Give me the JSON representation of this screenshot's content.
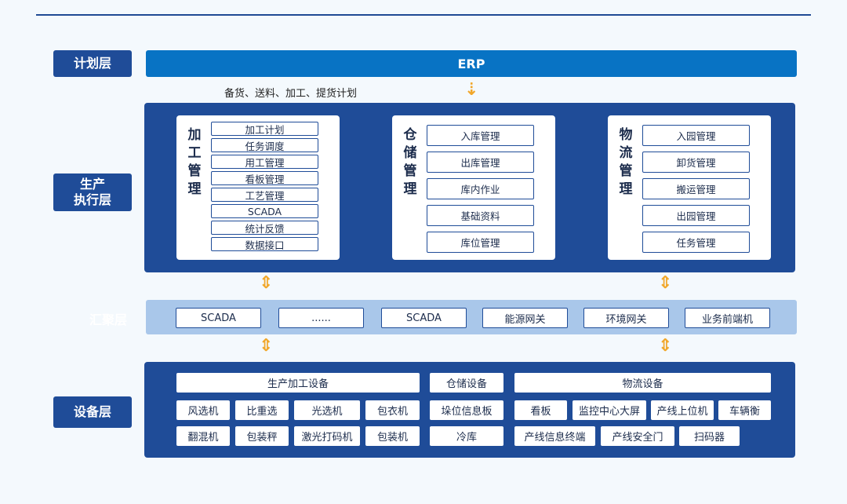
{
  "layers": {
    "plan": "计划层",
    "exec": "生产\n执行层",
    "agg": "汇聚层",
    "device": "设备层"
  },
  "erp": "ERP",
  "plan_note": "备货、送料、加工、提货计划",
  "exec_cards": [
    {
      "title": "加工管理",
      "items": [
        "加工计划",
        "任务调度",
        "用工管理",
        "看板管理",
        "工艺管理",
        "SCADA",
        "统计反馈",
        "数据接口"
      ]
    },
    {
      "title": "仓储管理",
      "items": [
        "入库管理",
        "出库管理",
        "库内作业",
        "基础资料",
        "库位管理"
      ]
    },
    {
      "title": "物流管理",
      "items": [
        "入园管理",
        "卸货管理",
        "搬运管理",
        "出园管理",
        "任务管理"
      ]
    }
  ],
  "agg_items": [
    "SCADA",
    "......",
    "SCADA",
    "能源网关",
    "环境网关",
    "业务前端机"
  ],
  "devices": {
    "groups": [
      "生产加工设备",
      "仓储设备",
      "物流设备"
    ],
    "production": [
      "风选机",
      "比重选",
      "光选机",
      "包衣机",
      "翻混机",
      "包装秤",
      "激光打码机",
      "包装机"
    ],
    "storage": [
      "垛位信息板",
      "冷库"
    ],
    "logistics": [
      "看板",
      "监控中心大屏",
      "产线上位机",
      "车辆衡",
      "产线信息终端",
      "产线安全门",
      "扫码器"
    ]
  },
  "colors": {
    "dark_blue": "#1f4c98",
    "erp_blue": "#0873c4",
    "agg_bg": "#a9c7ea",
    "arrow": "#f1a72a"
  }
}
